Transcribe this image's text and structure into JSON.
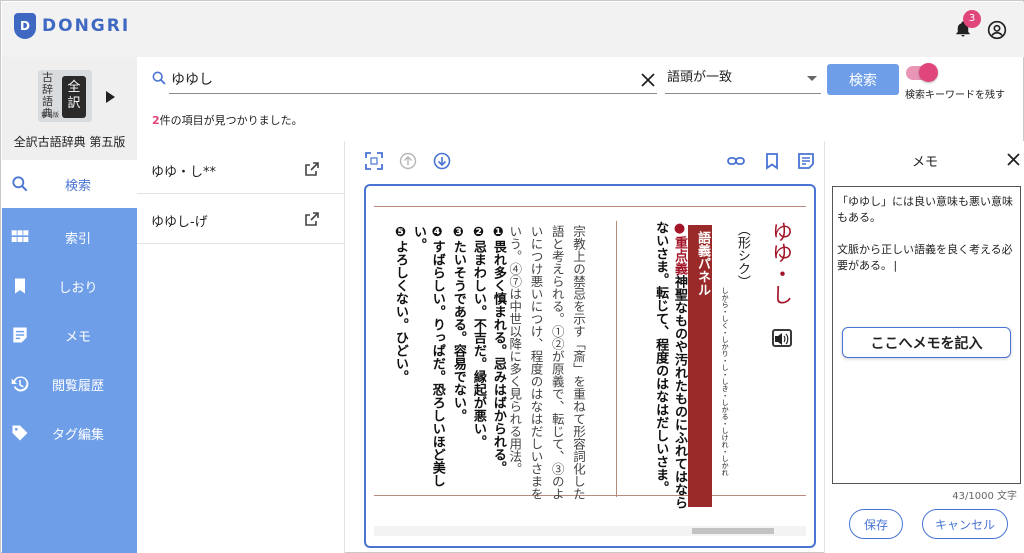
{
  "app": {
    "logo_text": "DONGRI",
    "logo_mark": "D",
    "notification_count": "3"
  },
  "dictionary": {
    "cover_small": "古辞語典",
    "cover_big": "全訳",
    "cover_edition": "第五版",
    "name": "全訳古語辞典 第五版"
  },
  "sidebar": {
    "items": [
      {
        "label": "検索",
        "icon": "search-icon"
      },
      {
        "label": "索引",
        "icon": "grid-icon"
      },
      {
        "label": "しおり",
        "icon": "bookmark-icon"
      },
      {
        "label": "メモ",
        "icon": "memo-icon"
      },
      {
        "label": "閲覧履歴",
        "icon": "history-icon"
      },
      {
        "label": "タグ編集",
        "icon": "tag-icon"
      }
    ]
  },
  "search": {
    "query": "ゆゆし",
    "match_mode": "語頭が一致",
    "button": "検索",
    "keep_keyword_label": "検索キーワードを残す",
    "result_count_num": "2",
    "result_count_text": "件の項目が見つかりました。"
  },
  "results": [
    {
      "title": "ゆゆ・し**"
    },
    {
      "title": "ゆゆし-げ"
    }
  ],
  "entry": {
    "headword": "ゆゆ・し",
    "conjugation": "（形シク）",
    "conj_forms": "しから・しく・しかり・し・しき・しかる・しけれ・しかれ",
    "panel_title": "語義パネル",
    "key_label": "●重点義",
    "key_text": "神聖なものや汚れたものにふれてはならないさま。転じて、程度のはなはだしいさま。",
    "note1": "宗教上の禁忌を示す「斎」を重ねて形容詞化した語と考えられる。①②が原義で、転じて、③のよいにつけ悪いにつけ、程度のはなはだしいさまをいう。④⑦は中世以降に多く見られる用法。",
    "sense1": "❶畏れ多く慎まれる。忌みはばかられる。",
    "sense2": "❷忌まわしい。不吉だ。縁起が悪い。",
    "sense3": "❸たいそうである。容易でない。",
    "sense4": "❹すばらしい。りっぱだ。恐ろしいほど美しい。",
    "sense5": "❺よろしくない。ひどい。"
  },
  "memo": {
    "title": "メモ",
    "text": "「ゆゆし」には良い意味も悪い意味もある。\n\n文脈から正しい語義を良く考える必要がある。|",
    "add_button": "ここへメモを記入",
    "counter": "43/1000 文字",
    "save": "保存",
    "cancel": "キャンセル"
  },
  "colors": {
    "accent": "#4a74d3",
    "sidebar": "#6f9ee9",
    "pink": "#e0457b",
    "dark_red": "#9a2a2a"
  }
}
